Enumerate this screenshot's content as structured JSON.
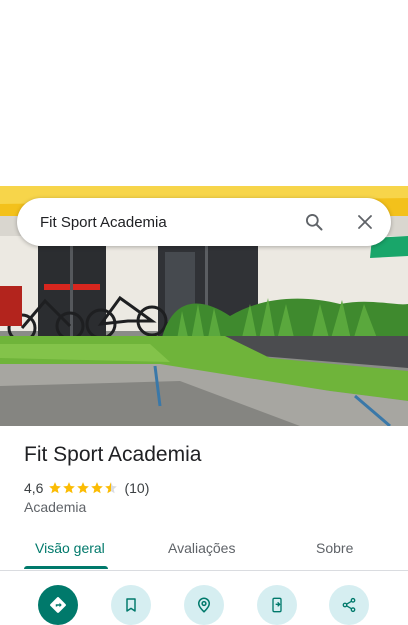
{
  "search": {
    "query": "Fit Sport Academia",
    "search_icon": "search-icon",
    "close_icon": "close-icon"
  },
  "place": {
    "name": "Fit Sport Academia",
    "rating": "4,6",
    "stars": 4.5,
    "review_count": "(10)",
    "category": "Academia"
  },
  "tabs": [
    {
      "label": "Visão geral",
      "active": true
    },
    {
      "label": "Avaliações",
      "active": false
    },
    {
      "label": "Sobre",
      "active": false
    }
  ],
  "actions": [
    {
      "icon": "directions-icon"
    },
    {
      "icon": "bookmark-icon"
    },
    {
      "icon": "nearby-icon"
    },
    {
      "icon": "send-to-phone-icon"
    },
    {
      "icon": "share-icon"
    }
  ],
  "colors": {
    "accent": "#00796b",
    "action_bg": "#d6eef1",
    "star": "#fbbc04"
  }
}
